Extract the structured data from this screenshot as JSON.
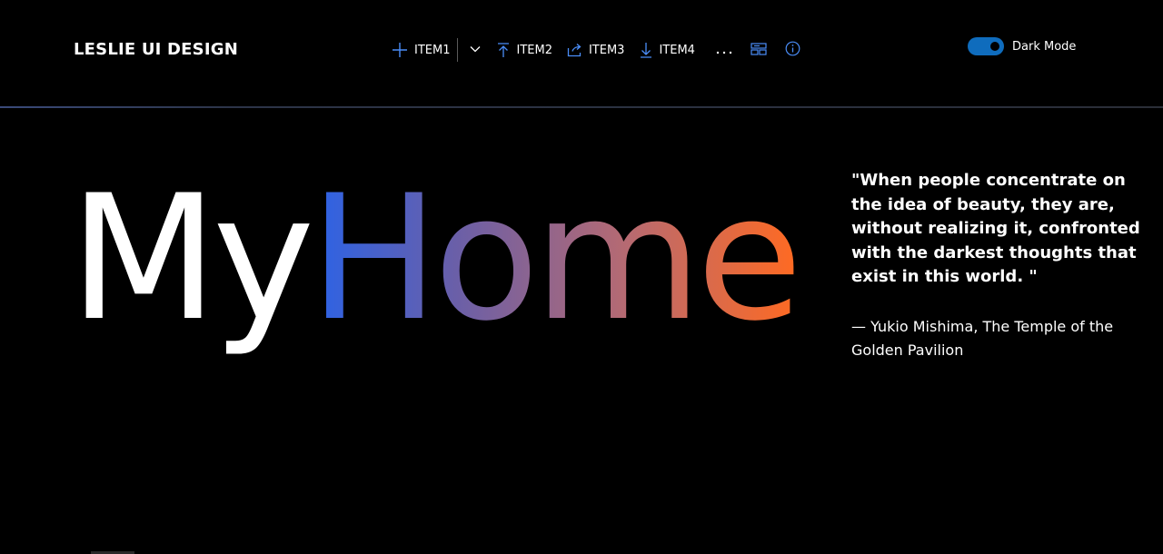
{
  "brand": {
    "title": "LESLIE UI DESIGN"
  },
  "toolbar": {
    "item1_label": "ITEM1",
    "item2_label": "ITEM2",
    "item3_label": "ITEM3",
    "item4_label": "ITEM4",
    "icons": {
      "item1": "plus-icon",
      "dropdown": "chevron-down-icon",
      "item2": "arrow-up-to-line-icon",
      "item3": "share-icon",
      "item4": "arrow-down-icon",
      "more": "more-horizontal-icon",
      "layout": "layout-icon",
      "info": "info-icon"
    },
    "accent": "#4a8df8"
  },
  "theme_toggle": {
    "label": "Dark Mode",
    "on": true,
    "color": "#0f6cbd"
  },
  "hero": {
    "word1": "My",
    "word2": "Home",
    "gradient": [
      "#2a63e8",
      "#6a5fa8",
      "#b66a72",
      "#ff6a22"
    ]
  },
  "quote": {
    "text": "\"When people concentrate on the idea of beauty, they are, without realizing it, confronted with the darkest thoughts that exist in this world. \"",
    "attribution": "— Yukio Mishima, The Temple of the Golden Pavilion"
  }
}
